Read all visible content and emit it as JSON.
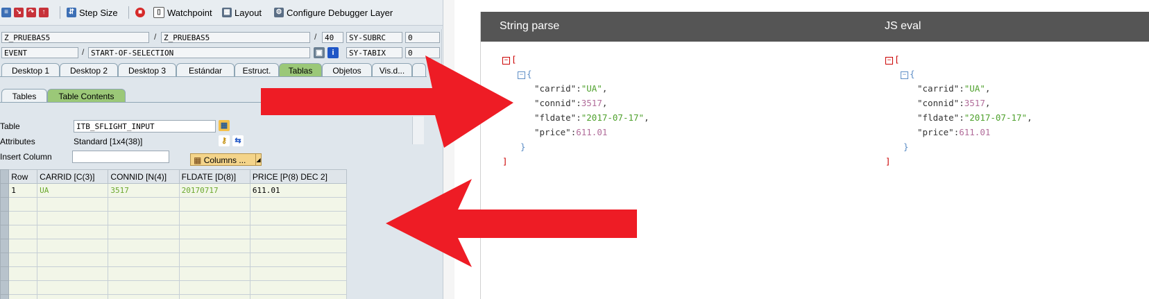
{
  "toolbar": {
    "step_size": "Step Size",
    "watchpoint": "Watchpoint",
    "layout": "Layout",
    "configure": "Configure Debugger Layer"
  },
  "context": {
    "program1": "Z_PRUEBAS5",
    "program2": "Z_PRUEBAS5",
    "line": "40",
    "sy_subrc_label": "SY-SUBRC",
    "sy_subrc_value": "0",
    "event": "EVENT",
    "event_name": "START-OF-SELECTION",
    "sy_tabix_label": "SY-TABIX",
    "sy_tabix_value": "0"
  },
  "tabs": [
    "Desktop 1",
    "Desktop 2",
    "Desktop 3",
    "Estándar",
    "Estruct.",
    "Tablas",
    "Objetos",
    "Vis.d..."
  ],
  "subtabs": [
    "Tables",
    "Table Contents"
  ],
  "table_form": {
    "table_label": "Table",
    "table_value": "ITB_SFLIGHT_INPUT",
    "attributes_label": "Attributes",
    "attributes_value": "Standard [1x4(38)]",
    "insert_label": "Insert Column",
    "columns_button": "Columns ..."
  },
  "grid": {
    "headers": [
      "Row",
      "CARRID [C(3)]",
      "CONNID [N(4)]",
      "FLDATE [D(8)]",
      "PRICE [P(8) DEC 2]"
    ],
    "row": [
      "1",
      "UA",
      "3517",
      "20170717",
      "611.01"
    ]
  },
  "viewer": {
    "left_title": "String parse",
    "right_title": "JS eval",
    "open_bracket": "[",
    "close_bracket": "]",
    "open_brace": "{",
    "close_brace": "}",
    "fields": [
      {
        "key": "\"carrid\"",
        "value": "\"UA\"",
        "type": "string",
        "trail": ","
      },
      {
        "key": "\"connid\"",
        "value": "3517",
        "type": "number",
        "trail": ","
      },
      {
        "key": "\"fldate\"",
        "value": "\"2017-07-17\"",
        "type": "string",
        "trail": ","
      },
      {
        "key": "\"price\"",
        "value": "611.01",
        "type": "number",
        "trail": ""
      }
    ]
  },
  "colors": {
    "arrow": "#ee1c25",
    "header_bg": "#555555",
    "active_tab": "#9bc878"
  }
}
